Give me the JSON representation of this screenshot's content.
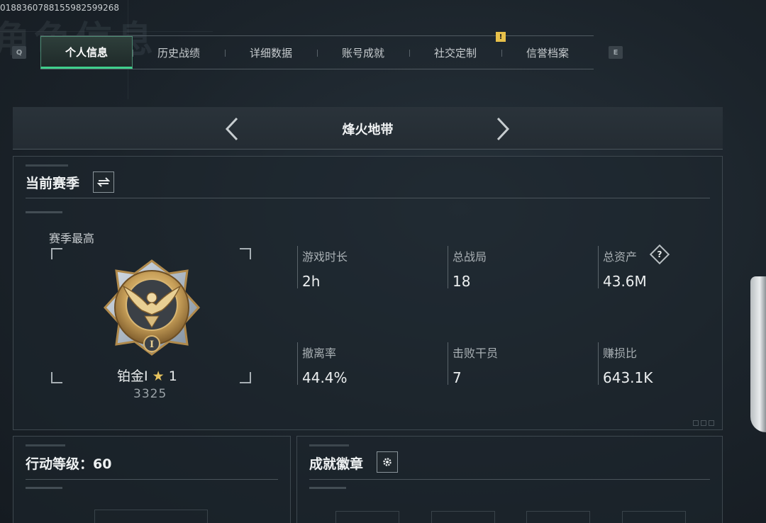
{
  "top": {
    "player_id": "0188360788155982599268",
    "bg_title": "角色信息",
    "key_left": "Q",
    "key_right": "E"
  },
  "tabs": [
    {
      "label": "个人信息",
      "active": true
    },
    {
      "label": "历史战绩",
      "active": false
    },
    {
      "label": "详细数据",
      "active": false
    },
    {
      "label": "账号成就",
      "active": false
    },
    {
      "label": "社交定制",
      "active": false,
      "alert": "!"
    },
    {
      "label": "信誉档案",
      "active": false
    }
  ],
  "mode": {
    "title": "烽火地带"
  },
  "season": {
    "title": "当前赛季",
    "best_label": "赛季最高",
    "rank_name": "铂金Ⅰ",
    "rank_star": "★",
    "rank_stars": "1",
    "rank_score": "3325",
    "stats": [
      {
        "label": "游戏时长",
        "value": "2h"
      },
      {
        "label": "总战局",
        "value": "18"
      },
      {
        "label": "总资产",
        "value": "43.6M",
        "help": "?"
      },
      {
        "label": "撤离率",
        "value": "44.4%"
      },
      {
        "label": "击败干员",
        "value": "7"
      },
      {
        "label": "赚损比",
        "value": "643.1K"
      }
    ]
  },
  "level_panel": {
    "title": "行动等级：60"
  },
  "badge_panel": {
    "title": "成就徽章"
  },
  "colors": {
    "accent": "#3fd08c",
    "alert": "#e7c04a",
    "medal_gold": "#c9a15a"
  }
}
